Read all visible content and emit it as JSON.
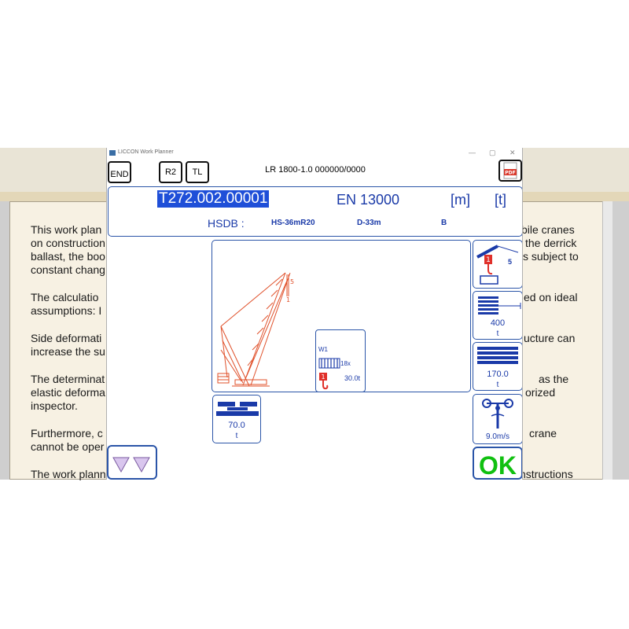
{
  "background_doc": {
    "left_lines": [
      "This work plan",
      "on construction",
      "ballast, the boo",
      "constant chang",
      "The calculatio",
      "assumptions: I",
      "Side deformati",
      "increase the su",
      "The determinat",
      "elastic deforma",
      "inspector.",
      "Furthermore, c",
      "cannot be oper",
      "The work plann"
    ],
    "right_lines": [
      "bile cranes",
      "the derrick",
      "s subject to",
      "ed on ideal",
      "ucture can",
      "as the",
      "orized",
      "crane",
      "nstructions"
    ]
  },
  "window": {
    "title": "LICCON Work Planner",
    "controls": [
      "—",
      "▢",
      "✕"
    ]
  },
  "toolbar": {
    "end_label": "END",
    "r2_label": "R2",
    "tl_label": "TL",
    "model_label": "LR 1800-1.0  000000/0000",
    "pdf_label": "PDF"
  },
  "info": {
    "code": "T272.002.00001",
    "norm": "EN 13000",
    "unit_length": "[m]",
    "unit_weight": "[t]",
    "hsdb_label": "HSDB :",
    "hsdb_value1": "HS-36mR20",
    "hsdb_value2": "D-33m",
    "hsdb_value3": "B"
  },
  "diagram": {
    "hook_top": "5",
    "hook_bottom": "1",
    "winch_label": "W1",
    "rope_label": "18x",
    "winch_load": "30.0t"
  },
  "tiles": {
    "hook_count": "5",
    "ballast_value": "400",
    "ballast_unit": "t",
    "counterweight_value": "170.0",
    "counterweight_unit": "t",
    "wind_value": "9.0m/s",
    "carbody_value": "70.0",
    "carbody_unit": "t",
    "ok_label": "OK"
  },
  "colors": {
    "accent_blue": "#2b55a8",
    "crane_red": "#e0502a",
    "code_highlight": "#1f4fd8",
    "ok_green": "#10c010"
  }
}
